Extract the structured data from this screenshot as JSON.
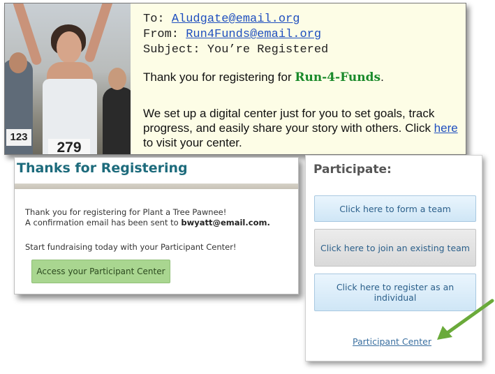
{
  "email": {
    "to_label": "To:",
    "to_value": "Aludgate@email.org",
    "from_label": "From:",
    "from_value": "Run4Funds@email.org",
    "subject_label": "Subject:",
    "subject_value": "You’re Registered",
    "line1_prefix": "Thank you for registering for ",
    "brand": "Run-4-Funds",
    "line1_suffix": ".",
    "line2_part1": "We set up a digital center just for you to set goals, track progress, and easily share your story with others. Click ",
    "line2_link": "here",
    "line2_part2": " to visit your center.",
    "photo": {
      "bib_left": "123",
      "bib_main": "279"
    }
  },
  "thanks": {
    "title": "Thanks for Registering",
    "message_line1": "Thank you for registering for Plant a Tree Pawnee!",
    "message_line2_prefix": "A confirmation email has been sent to ",
    "message_email": "bwyatt@email.com.",
    "start_text": "Start fundraising today with your Participant Center!",
    "access_button": "Access your Participant Center"
  },
  "participate": {
    "title": "Participate:",
    "buttons": [
      "Click here to form a team",
      "Click here to join an existing team",
      "Click here to register as an individual"
    ],
    "link": "Participant Center"
  },
  "colors": {
    "brand_green": "#1a8a2a",
    "link_blue": "#1f4fbf",
    "title_teal": "#1d6b7c",
    "access_green": "#a9d690",
    "arrow_green": "#6aaa3a"
  }
}
